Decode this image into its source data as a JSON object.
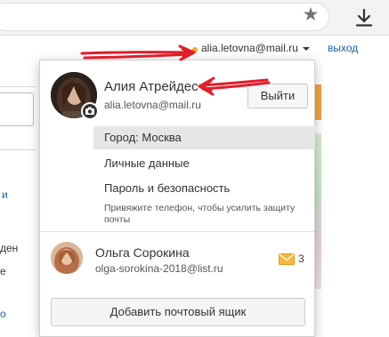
{
  "header": {
    "user_email": "alia.letovna@mail.ru",
    "logout_link": "выход"
  },
  "side_fragments": [
    "и",
    "ден",
    "е",
    "о"
  ],
  "dropdown": {
    "profile": {
      "name": "Алия Атрейдес",
      "email": "alia.letovna@mail.ru",
      "logout_button": "Выйти"
    },
    "menu": [
      {
        "label": "Город: Москва",
        "active": true
      },
      {
        "label": "Личные данные",
        "active": false
      },
      {
        "label": "Пароль и безопасность",
        "active": false
      }
    ],
    "hint": "Привяжите телефон, чтобы усилить защиту почты",
    "other_account": {
      "name": "Ольга Сорокина",
      "email": "olga-sorokina-2018@list.ru",
      "unread": "3"
    },
    "add_mailbox_button": "Добавить почтовый ящик"
  },
  "colors": {
    "accent_orange": "#f6a623",
    "link_blue": "#1a5fb4",
    "annotation_red": "#e11d2a"
  },
  "icons": [
    "star-icon",
    "download-icon",
    "camera-icon",
    "envelope-icon",
    "caret-down-icon"
  ]
}
